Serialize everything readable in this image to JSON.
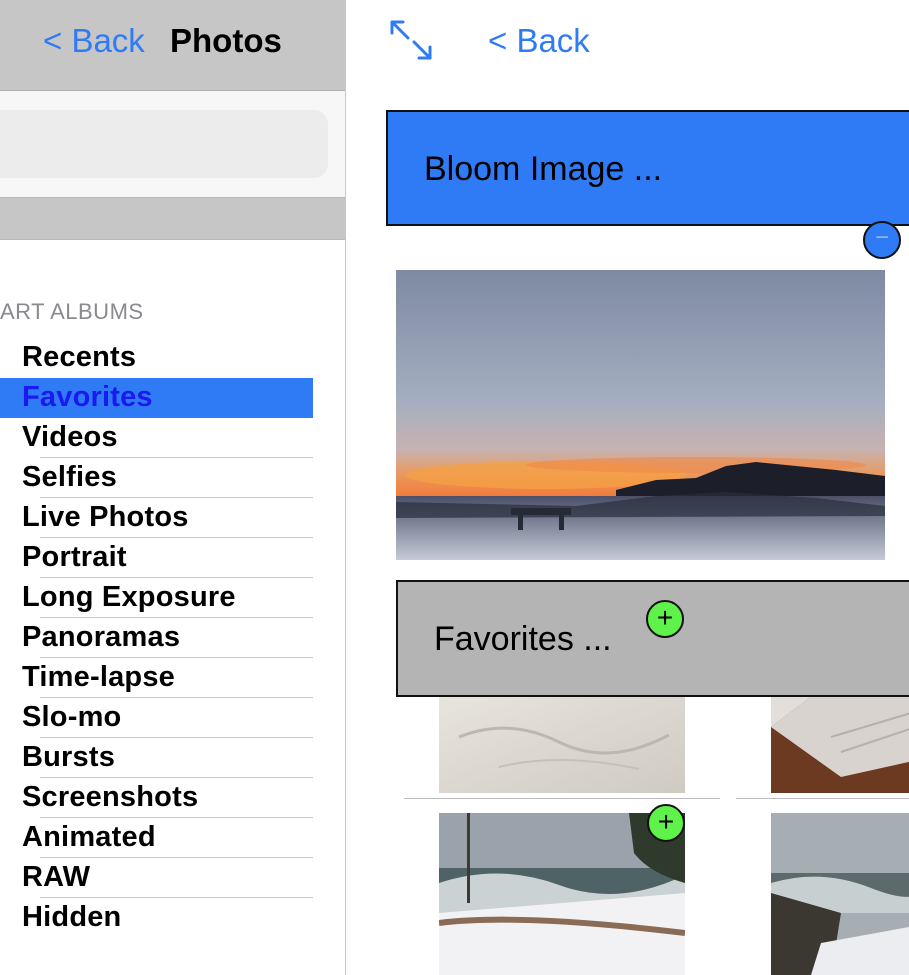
{
  "sidebar": {
    "back_label": "< Back",
    "title": "Photos",
    "section_header": "ART ALBUMS",
    "albums": [
      {
        "label": "Recents"
      },
      {
        "label": "Favorites",
        "selected": true
      },
      {
        "label": "Videos"
      },
      {
        "label": "Selfies"
      },
      {
        "label": "Live Photos"
      },
      {
        "label": "Portrait"
      },
      {
        "label": "Long Exposure"
      },
      {
        "label": "Panoramas"
      },
      {
        "label": "Time-lapse"
      },
      {
        "label": "Slo-mo"
      },
      {
        "label": "Bursts"
      },
      {
        "label": "Screenshots"
      },
      {
        "label": "Animated"
      },
      {
        "label": "RAW"
      },
      {
        "label": "Hidden"
      }
    ]
  },
  "detail": {
    "back_label": "< Back",
    "expand_icon": "expand-arrows-icon",
    "bloom_label": "Bloom Image ...",
    "favorites_label": "Favorites ...",
    "minus_symbol": "−",
    "plus_symbol": "+"
  },
  "colors": {
    "accent": "#2f7bf5",
    "header_gray": "#c6c6c6",
    "selected_text": "#1a1af0",
    "plus_green": "#5ff24a",
    "favorites_block": "#b4b4b4"
  }
}
